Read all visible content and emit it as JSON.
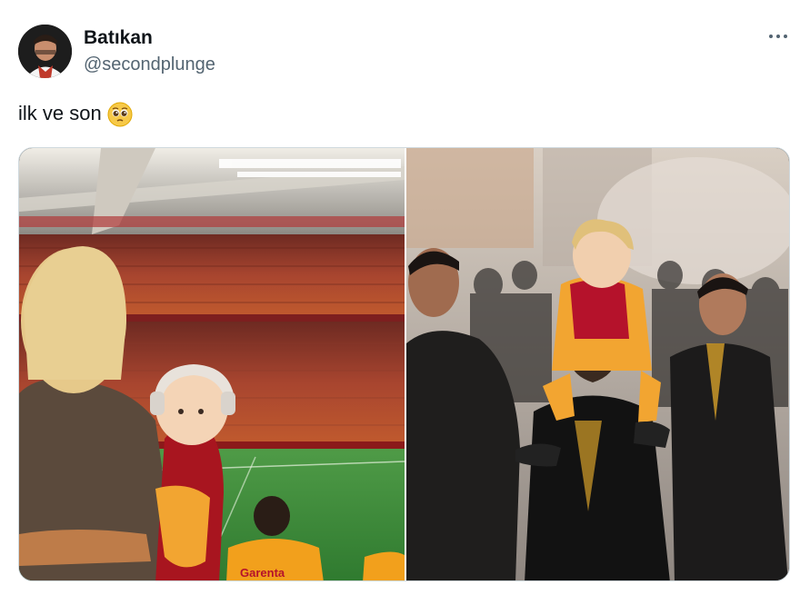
{
  "user": {
    "display_name": "Batıkan",
    "handle": "@secondplunge",
    "avatar_icon": "profile-photo"
  },
  "tweet": {
    "text": "ilk ve son",
    "emoji": "pleading-face-emoji"
  },
  "menu": {
    "icon": "more-options-icon"
  },
  "media": {
    "left_photo": {
      "description_icon": "stadium-photo",
      "banner_text": "Garenta"
    },
    "right_photo": {
      "description_icon": "celebration-photo"
    }
  },
  "colors": {
    "text_primary": "#0f1419",
    "text_secondary": "#536471",
    "border": "#cfd9de",
    "team_red": "#b5122b",
    "team_yellow": "#f2a01c",
    "pitch_green": "#3e8f3a"
  }
}
